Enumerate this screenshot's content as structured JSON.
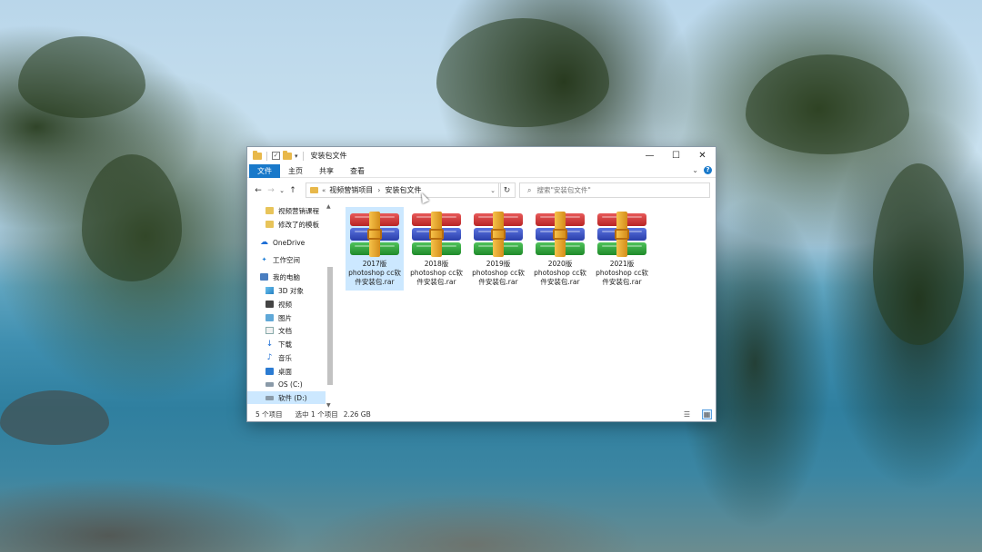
{
  "window": {
    "title": "安装包文件",
    "controls": {
      "minimize": "—",
      "maximize": "☐",
      "close": "✕"
    }
  },
  "ribbon": {
    "tabs": [
      {
        "label": "文件",
        "active": true
      },
      {
        "label": "主页"
      },
      {
        "label": "共享"
      },
      {
        "label": "查看"
      }
    ],
    "help": "?"
  },
  "address": {
    "overflow": "«",
    "crumbs": [
      "视频营销项目",
      "安装包文件"
    ],
    "separator": "›"
  },
  "search": {
    "placeholder": "搜索\"安装包文件\""
  },
  "nav": {
    "items": [
      {
        "label": "视频营销课程",
        "icon": "folder-icon"
      },
      {
        "label": "修改了的模板",
        "icon": "folder-icon"
      },
      {
        "label": "OneDrive",
        "icon": "cloud-icon"
      },
      {
        "label": "工作空间",
        "icon": "star-icon"
      },
      {
        "label": "我的电脑",
        "icon": "computer-icon"
      },
      {
        "label": "3D 对象",
        "icon": "3d-objects-icon"
      },
      {
        "label": "视频",
        "icon": "videos-icon"
      },
      {
        "label": "图片",
        "icon": "pictures-icon"
      },
      {
        "label": "文档",
        "icon": "documents-icon"
      },
      {
        "label": "下载",
        "icon": "downloads-icon"
      },
      {
        "label": "音乐",
        "icon": "music-icon"
      },
      {
        "label": "桌面",
        "icon": "desktop-icon"
      },
      {
        "label": "OS (C:)",
        "icon": "drive-icon"
      },
      {
        "label": "软件 (D:)",
        "icon": "drive-icon",
        "selected": true
      }
    ]
  },
  "files": [
    {
      "name": "2017版photoshop cc软件安装包.rar",
      "line1": "2017版",
      "line2": "photoshop cc软",
      "line3": "件安装包.rar",
      "selected": true
    },
    {
      "name": "2018版photoshop cc软件安装包.rar",
      "line1": "2018版",
      "line2": "photoshop cc软",
      "line3": "件安装包.rar"
    },
    {
      "name": "2019版photoshop cc软件安装包.rar",
      "line1": "2019版",
      "line2": "photoshop cc软",
      "line3": "件安装包.rar"
    },
    {
      "name": "2020版photoshop cc软件安装包.rar",
      "line1": "2020版",
      "line2": "photoshop cc软",
      "line3": "件安装包.rar"
    },
    {
      "name": "2021版photoshop cc软件安装包.rar",
      "line1": "2021版",
      "line2": "photoshop cc软",
      "line3": "件安装包.rar"
    }
  ],
  "status": {
    "item_count": "5 个项目",
    "selection": "选中 1 个项目",
    "size": "2.26 GB"
  },
  "colors": {
    "accent": "#1979ca",
    "selection": "#cce8ff"
  }
}
